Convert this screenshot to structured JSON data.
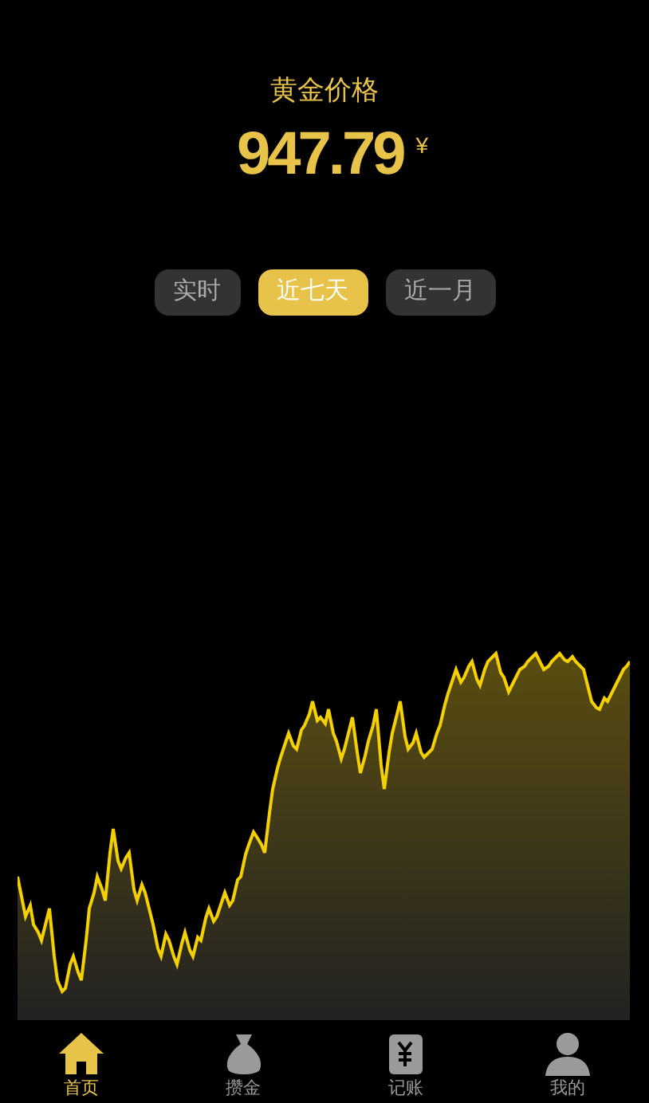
{
  "header": {
    "title": "黄金价格",
    "price": "947.79",
    "currency": "¥"
  },
  "tabs": [
    {
      "label": "实时",
      "selected": false
    },
    {
      "label": "近七天",
      "selected": true
    },
    {
      "label": "近一月",
      "selected": false
    }
  ],
  "nav": [
    {
      "label": "首页",
      "selected": true
    },
    {
      "label": "攒金",
      "selected": false
    },
    {
      "label": "记账",
      "selected": false
    },
    {
      "label": "我的",
      "selected": false
    }
  ]
}
